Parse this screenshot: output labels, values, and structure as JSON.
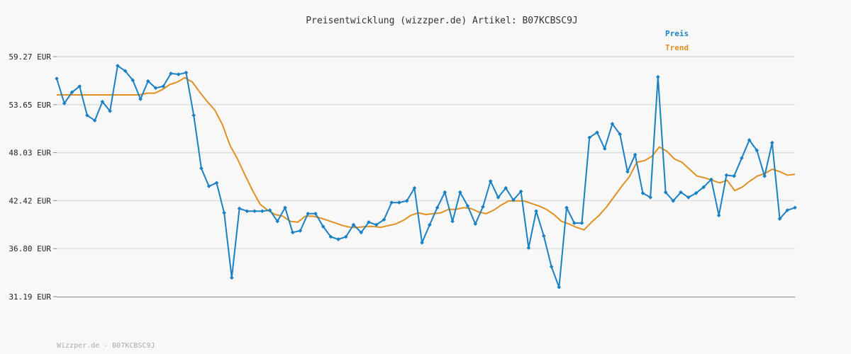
{
  "chart_data": {
    "type": "line",
    "title": "Preisentwicklung (wizzper.de) Artikel: B07KCBSC9J",
    "xlabel": "",
    "ylabel": "",
    "y_ticks": [
      "59.27 EUR",
      "53.65 EUR",
      "48.03 EUR",
      "42.42 EUR",
      "36.80 EUR",
      "31.19 EUR"
    ],
    "ylim": [
      31.19,
      59.27
    ],
    "grid": true,
    "legend_position": "top-right",
    "series": [
      {
        "name": "Preis",
        "color": "#1a80c4",
        "values": [
          56.7,
          53.8,
          55.1,
          55.8,
          52.4,
          51.8,
          54.0,
          52.9,
          58.2,
          57.6,
          56.5,
          54.3,
          56.4,
          55.6,
          55.8,
          57.3,
          57.2,
          57.4,
          52.4,
          46.2,
          44.1,
          44.5,
          41.0,
          33.4,
          41.5,
          41.2,
          41.2,
          41.2,
          41.3,
          40.0,
          41.6,
          38.7,
          38.9,
          40.9,
          40.9,
          39.4,
          38.2,
          37.9,
          38.2,
          39.6,
          38.7,
          39.9,
          39.6,
          40.2,
          42.2,
          42.2,
          42.4,
          43.9,
          37.5,
          39.6,
          41.6,
          43.4,
          40.0,
          43.4,
          41.8,
          39.7,
          41.7,
          44.7,
          42.8,
          43.9,
          42.5,
          43.5,
          36.9,
          41.2,
          38.3,
          34.7,
          32.3,
          41.6,
          39.8,
          39.8,
          49.8,
          50.4,
          48.5,
          51.4,
          50.2,
          45.8,
          47.8,
          43.3,
          42.8,
          56.9,
          43.4,
          42.4,
          43.4,
          42.8,
          43.3,
          44.0,
          44.9,
          40.7,
          45.4,
          45.3,
          47.4,
          49.5,
          48.3,
          45.3,
          49.2,
          40.3,
          41.3,
          41.6
        ]
      },
      {
        "name": "Trend",
        "color": "#e09020",
        "values": [
          54.8,
          54.8,
          54.8,
          54.8,
          54.8,
          54.8,
          54.8,
          54.8,
          54.8,
          54.8,
          54.8,
          54.8,
          55.0,
          55.0,
          55.4,
          56.0,
          56.3,
          56.8,
          56.3,
          55.1,
          54.0,
          53.0,
          51.3,
          48.9,
          47.3,
          45.4,
          43.6,
          42.0,
          41.3,
          40.8,
          40.6,
          40.0,
          39.9,
          40.6,
          40.6,
          40.4,
          40.1,
          39.8,
          39.5,
          39.3,
          39.3,
          39.4,
          39.4,
          39.3,
          39.5,
          39.7,
          40.1,
          40.7,
          41.0,
          40.8,
          40.9,
          41.0,
          41.4,
          41.4,
          41.6,
          41.5,
          41.1,
          40.9,
          41.3,
          41.9,
          42.4,
          42.4,
          42.4,
          42.1,
          41.8,
          41.4,
          40.8,
          40.0,
          39.7,
          39.3,
          39.0,
          39.9,
          40.7,
          41.7,
          42.9,
          44.1,
          45.2,
          46.9,
          47.1,
          47.6,
          48.7,
          48.2,
          47.3,
          46.9,
          46.1,
          45.3,
          45.1,
          44.8,
          44.5,
          44.8,
          43.6,
          44.0,
          44.7,
          45.3,
          45.6,
          46.1,
          45.8,
          45.4,
          45.5
        ]
      }
    ]
  },
  "footer": {
    "text": "Wizzper.de - B07KCBSC9J"
  }
}
